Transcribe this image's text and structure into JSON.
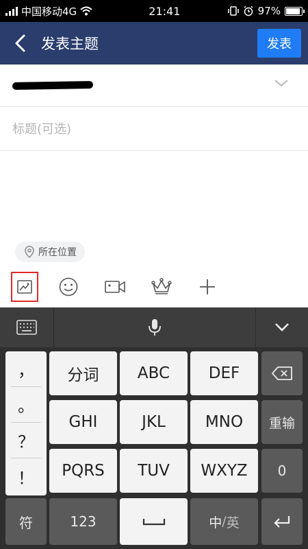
{
  "status": {
    "carrier": "中国移动4G",
    "time": "21:41",
    "battery": "97%",
    "battery_level": 0.97
  },
  "header": {
    "title": "发表主题",
    "publish_label": "发表"
  },
  "forum": {
    "name_redacted": true
  },
  "title_field": {
    "value": "",
    "placeholder": "标题(可选)"
  },
  "location": {
    "label": "所在位置"
  },
  "toolbar": {
    "items": [
      "image-icon",
      "emoji-icon",
      "video-icon",
      "crown-icon",
      "plus-icon"
    ]
  },
  "keyboard": {
    "punct": [
      "，",
      "。",
      "？",
      "！"
    ],
    "row1": [
      "分词",
      "ABC",
      "DEF"
    ],
    "row2": [
      "GHI",
      "JKL",
      "MNO"
    ],
    "row3": [
      "PQRS",
      "TUV",
      "WXYZ"
    ],
    "reinput": "重输",
    "zero": "0",
    "symbol": "符",
    "num": "123",
    "zh": "中",
    "sep": "/",
    "en": "英"
  }
}
